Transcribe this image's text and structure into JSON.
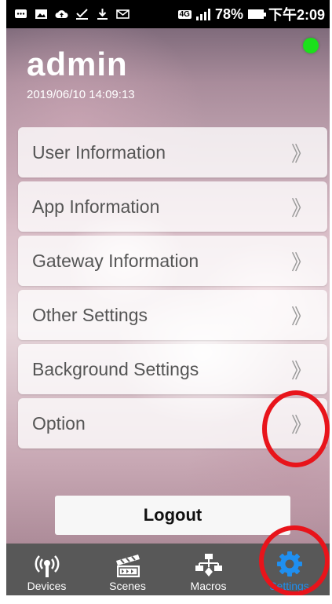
{
  "status_bar": {
    "network": "4G",
    "battery": "78%",
    "time": "下午2:09"
  },
  "header": {
    "username": "admin",
    "timestamp": "2019/06/10 14:09:13"
  },
  "menu": {
    "items": [
      {
        "label": "User Information"
      },
      {
        "label": "App Information"
      },
      {
        "label": "Gateway Information"
      },
      {
        "label": "Other Settings"
      },
      {
        "label": "Background Settings"
      },
      {
        "label": "Option"
      }
    ],
    "chevron": "》"
  },
  "logout_label": "Logout",
  "tabs": [
    {
      "label": "Devices",
      "icon": "remote-signal-icon"
    },
    {
      "label": "Scenes",
      "icon": "clapperboard-icon"
    },
    {
      "label": "Macros",
      "icon": "flowchart-icon"
    },
    {
      "label": "Settings",
      "icon": "gear-icon",
      "active": true
    }
  ],
  "colors": {
    "online_indicator": "#1be01b",
    "active_tab": "#1f8ff0",
    "annotation_circle": "#e8141b",
    "tab_bar": "#585858"
  }
}
